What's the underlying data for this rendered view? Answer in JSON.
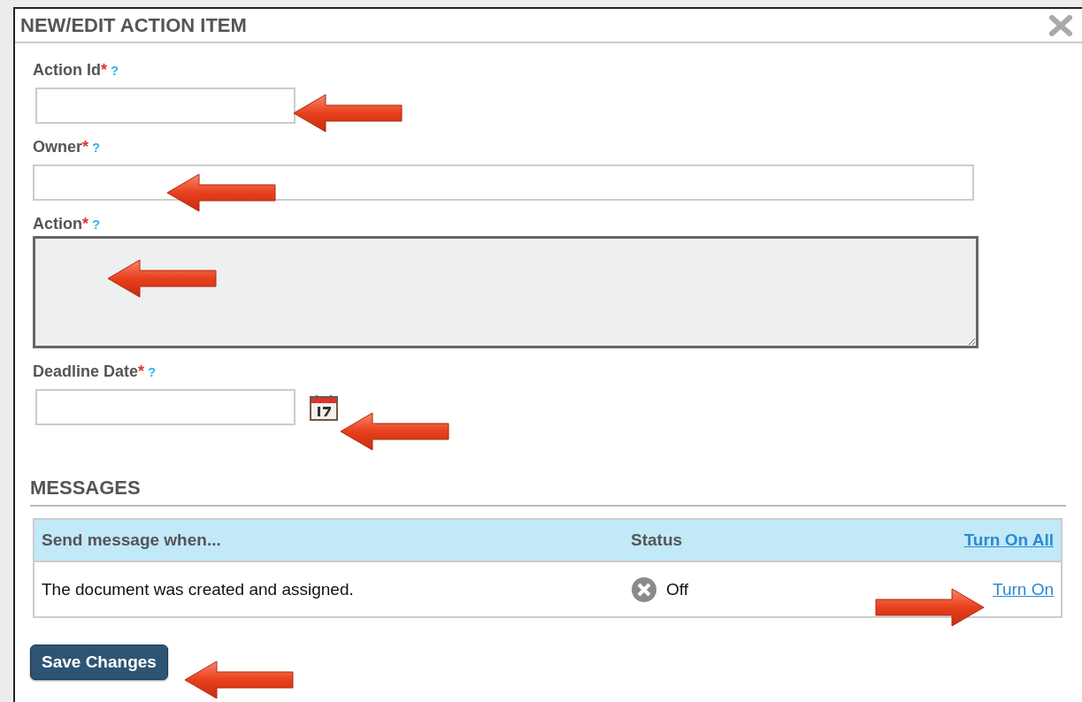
{
  "dialog": {
    "title": "NEW/EDIT ACTION ITEM"
  },
  "fields": [
    {
      "kind": "short",
      "label": "Action Id",
      "required_mark": "*",
      "help": "?"
    },
    {
      "kind": "wide",
      "label": "Owner",
      "required_mark": "*",
      "help": "?"
    },
    {
      "kind": "textarea",
      "label": "Action",
      "required_mark": "*",
      "help": "?"
    },
    {
      "kind": "date",
      "label": "Deadline Date",
      "required_mark": "*",
      "help": "?"
    }
  ],
  "messages": {
    "title": "MESSAGES",
    "columns": [
      "Send message when...",
      "Status"
    ],
    "turn_on_all": "Turn On All",
    "rows": [
      {
        "text": "The document was created and assigned.",
        "on": false,
        "status": "Off",
        "action": "Turn On"
      }
    ]
  },
  "save_button": "Save Changes"
}
